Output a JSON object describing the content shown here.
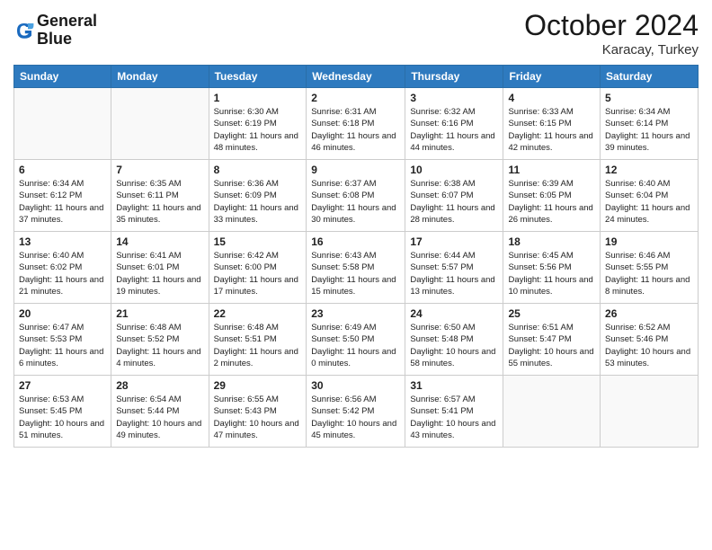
{
  "logo": {
    "line1": "General",
    "line2": "Blue"
  },
  "title": {
    "month_year": "October 2024",
    "location": "Karacay, Turkey"
  },
  "days_of_week": [
    "Sunday",
    "Monday",
    "Tuesday",
    "Wednesday",
    "Thursday",
    "Friday",
    "Saturday"
  ],
  "weeks": [
    [
      {
        "day": "",
        "sunrise": "",
        "sunset": "",
        "daylight": ""
      },
      {
        "day": "",
        "sunrise": "",
        "sunset": "",
        "daylight": ""
      },
      {
        "day": "1",
        "sunrise": "Sunrise: 6:30 AM",
        "sunset": "Sunset: 6:19 PM",
        "daylight": "Daylight: 11 hours and 48 minutes."
      },
      {
        "day": "2",
        "sunrise": "Sunrise: 6:31 AM",
        "sunset": "Sunset: 6:18 PM",
        "daylight": "Daylight: 11 hours and 46 minutes."
      },
      {
        "day": "3",
        "sunrise": "Sunrise: 6:32 AM",
        "sunset": "Sunset: 6:16 PM",
        "daylight": "Daylight: 11 hours and 44 minutes."
      },
      {
        "day": "4",
        "sunrise": "Sunrise: 6:33 AM",
        "sunset": "Sunset: 6:15 PM",
        "daylight": "Daylight: 11 hours and 42 minutes."
      },
      {
        "day": "5",
        "sunrise": "Sunrise: 6:34 AM",
        "sunset": "Sunset: 6:14 PM",
        "daylight": "Daylight: 11 hours and 39 minutes."
      }
    ],
    [
      {
        "day": "6",
        "sunrise": "Sunrise: 6:34 AM",
        "sunset": "Sunset: 6:12 PM",
        "daylight": "Daylight: 11 hours and 37 minutes."
      },
      {
        "day": "7",
        "sunrise": "Sunrise: 6:35 AM",
        "sunset": "Sunset: 6:11 PM",
        "daylight": "Daylight: 11 hours and 35 minutes."
      },
      {
        "day": "8",
        "sunrise": "Sunrise: 6:36 AM",
        "sunset": "Sunset: 6:09 PM",
        "daylight": "Daylight: 11 hours and 33 minutes."
      },
      {
        "day": "9",
        "sunrise": "Sunrise: 6:37 AM",
        "sunset": "Sunset: 6:08 PM",
        "daylight": "Daylight: 11 hours and 30 minutes."
      },
      {
        "day": "10",
        "sunrise": "Sunrise: 6:38 AM",
        "sunset": "Sunset: 6:07 PM",
        "daylight": "Daylight: 11 hours and 28 minutes."
      },
      {
        "day": "11",
        "sunrise": "Sunrise: 6:39 AM",
        "sunset": "Sunset: 6:05 PM",
        "daylight": "Daylight: 11 hours and 26 minutes."
      },
      {
        "day": "12",
        "sunrise": "Sunrise: 6:40 AM",
        "sunset": "Sunset: 6:04 PM",
        "daylight": "Daylight: 11 hours and 24 minutes."
      }
    ],
    [
      {
        "day": "13",
        "sunrise": "Sunrise: 6:40 AM",
        "sunset": "Sunset: 6:02 PM",
        "daylight": "Daylight: 11 hours and 21 minutes."
      },
      {
        "day": "14",
        "sunrise": "Sunrise: 6:41 AM",
        "sunset": "Sunset: 6:01 PM",
        "daylight": "Daylight: 11 hours and 19 minutes."
      },
      {
        "day": "15",
        "sunrise": "Sunrise: 6:42 AM",
        "sunset": "Sunset: 6:00 PM",
        "daylight": "Daylight: 11 hours and 17 minutes."
      },
      {
        "day": "16",
        "sunrise": "Sunrise: 6:43 AM",
        "sunset": "Sunset: 5:58 PM",
        "daylight": "Daylight: 11 hours and 15 minutes."
      },
      {
        "day": "17",
        "sunrise": "Sunrise: 6:44 AM",
        "sunset": "Sunset: 5:57 PM",
        "daylight": "Daylight: 11 hours and 13 minutes."
      },
      {
        "day": "18",
        "sunrise": "Sunrise: 6:45 AM",
        "sunset": "Sunset: 5:56 PM",
        "daylight": "Daylight: 11 hours and 10 minutes."
      },
      {
        "day": "19",
        "sunrise": "Sunrise: 6:46 AM",
        "sunset": "Sunset: 5:55 PM",
        "daylight": "Daylight: 11 hours and 8 minutes."
      }
    ],
    [
      {
        "day": "20",
        "sunrise": "Sunrise: 6:47 AM",
        "sunset": "Sunset: 5:53 PM",
        "daylight": "Daylight: 11 hours and 6 minutes."
      },
      {
        "day": "21",
        "sunrise": "Sunrise: 6:48 AM",
        "sunset": "Sunset: 5:52 PM",
        "daylight": "Daylight: 11 hours and 4 minutes."
      },
      {
        "day": "22",
        "sunrise": "Sunrise: 6:48 AM",
        "sunset": "Sunset: 5:51 PM",
        "daylight": "Daylight: 11 hours and 2 minutes."
      },
      {
        "day": "23",
        "sunrise": "Sunrise: 6:49 AM",
        "sunset": "Sunset: 5:50 PM",
        "daylight": "Daylight: 11 hours and 0 minutes."
      },
      {
        "day": "24",
        "sunrise": "Sunrise: 6:50 AM",
        "sunset": "Sunset: 5:48 PM",
        "daylight": "Daylight: 10 hours and 58 minutes."
      },
      {
        "day": "25",
        "sunrise": "Sunrise: 6:51 AM",
        "sunset": "Sunset: 5:47 PM",
        "daylight": "Daylight: 10 hours and 55 minutes."
      },
      {
        "day": "26",
        "sunrise": "Sunrise: 6:52 AM",
        "sunset": "Sunset: 5:46 PM",
        "daylight": "Daylight: 10 hours and 53 minutes."
      }
    ],
    [
      {
        "day": "27",
        "sunrise": "Sunrise: 6:53 AM",
        "sunset": "Sunset: 5:45 PM",
        "daylight": "Daylight: 10 hours and 51 minutes."
      },
      {
        "day": "28",
        "sunrise": "Sunrise: 6:54 AM",
        "sunset": "Sunset: 5:44 PM",
        "daylight": "Daylight: 10 hours and 49 minutes."
      },
      {
        "day": "29",
        "sunrise": "Sunrise: 6:55 AM",
        "sunset": "Sunset: 5:43 PM",
        "daylight": "Daylight: 10 hours and 47 minutes."
      },
      {
        "day": "30",
        "sunrise": "Sunrise: 6:56 AM",
        "sunset": "Sunset: 5:42 PM",
        "daylight": "Daylight: 10 hours and 45 minutes."
      },
      {
        "day": "31",
        "sunrise": "Sunrise: 6:57 AM",
        "sunset": "Sunset: 5:41 PM",
        "daylight": "Daylight: 10 hours and 43 minutes."
      },
      {
        "day": "",
        "sunrise": "",
        "sunset": "",
        "daylight": ""
      },
      {
        "day": "",
        "sunrise": "",
        "sunset": "",
        "daylight": ""
      }
    ]
  ]
}
